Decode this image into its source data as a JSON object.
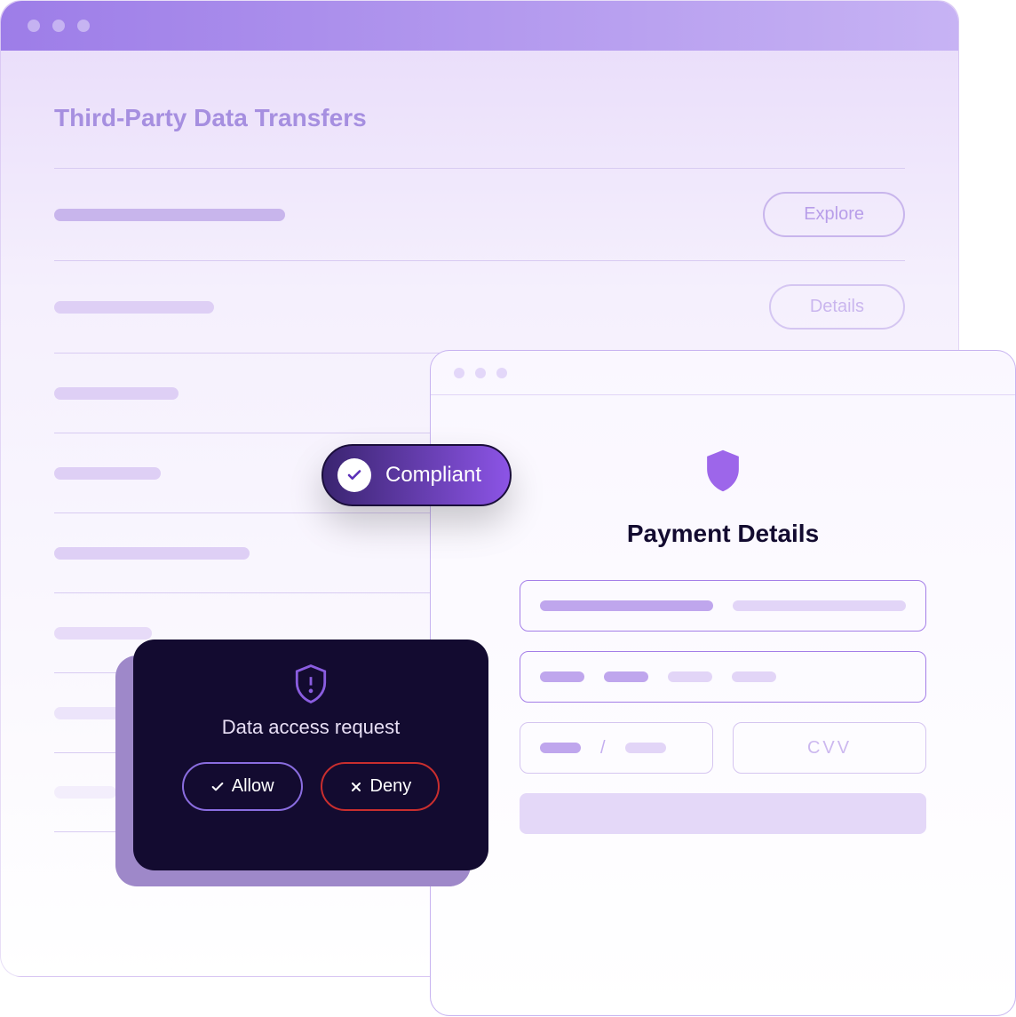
{
  "main": {
    "title": "Third-Party Data Transfers",
    "rows": [
      {
        "button": "Explore"
      },
      {
        "button": "Details"
      }
    ]
  },
  "compliant": {
    "label": "Compliant"
  },
  "payment": {
    "title": "Payment Details",
    "cvv_placeholder": "CVV"
  },
  "modal": {
    "title": "Data access request",
    "allow_label": "Allow",
    "deny_label": "Deny"
  }
}
